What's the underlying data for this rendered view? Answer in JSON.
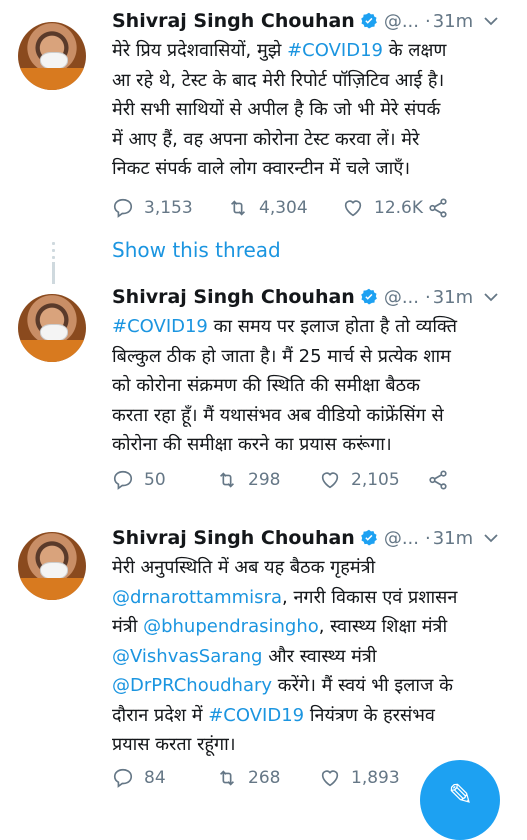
{
  "tweets": [
    {
      "name": "Shivraj Singh Chouhan",
      "handle": "@...",
      "dot": "·",
      "time": "31m",
      "lines": [
        {
          "segs": [
            {
              "t": "मेरे प्रिय प्रदेशवासियों, मुझे ",
              "c": "text"
            },
            {
              "t": "#COVID19",
              "c": "link"
            },
            {
              "t": " के लक्षण",
              "c": "text"
            }
          ]
        },
        {
          "segs": [
            {
              "t": "आ रहे थे, टेस्ट के बाद मेरी रिपोर्ट पॉज़िटिव आई है।",
              "c": "text"
            }
          ]
        },
        {
          "segs": [
            {
              "t": "मेरी सभी साथियों से अपील है कि जो भी मेरे संपर्क",
              "c": "text"
            }
          ]
        },
        {
          "segs": [
            {
              "t": "में आए हैं, वह अपना कोरोना टेस्ट करवा लें। मेरे",
              "c": "text"
            }
          ]
        },
        {
          "segs": [
            {
              "t": "निकट संपर्क वाले लोग क्वारन्टीन में चले जाएँ।",
              "c": "text"
            }
          ]
        }
      ],
      "replies": "3,153",
      "retweets": "4,304",
      "likes": "12.6K"
    },
    {
      "name": "Shivraj Singh Chouhan",
      "handle": "@...",
      "dot": "·",
      "time": "31m",
      "lines": [
        {
          "segs": [
            {
              "t": "#COVID19",
              "c": "link"
            },
            {
              "t": " का समय पर इलाज होता है तो व्यक्ति",
              "c": "text"
            }
          ]
        },
        {
          "segs": [
            {
              "t": "बिल्कुल ठीक हो जाता है। मैं 25 मार्च से प्रत्येक शाम",
              "c": "text"
            }
          ]
        },
        {
          "segs": [
            {
              "t": "को कोरोना संक्रमण की स्थिति की समीक्षा बैठक",
              "c": "text"
            }
          ]
        },
        {
          "segs": [
            {
              "t": "करता रहा हूँ। मैं यथासंभव अब वीडियो कांफ्रेंसिंग से",
              "c": "text"
            }
          ]
        },
        {
          "segs": [
            {
              "t": "कोरोना की समीक्षा करने का प्रयास करूंगा।",
              "c": "text"
            }
          ]
        }
      ],
      "replies": "50",
      "retweets": "298",
      "likes": "2,105"
    },
    {
      "name": "Shivraj Singh Chouhan",
      "handle": "@...",
      "dot": "·",
      "time": "31m",
      "lines": [
        {
          "segs": [
            {
              "t": "मेरी अनुपस्थिति में अब यह बैठक गृहमंत्री",
              "c": "text"
            }
          ]
        },
        {
          "segs": [
            {
              "t": "@drnarottammisra",
              "c": "link"
            },
            {
              "t": ", नगरी विकास एवं प्रशासन",
              "c": "text"
            }
          ]
        },
        {
          "segs": [
            {
              "t": "मंत्री ",
              "c": "text"
            },
            {
              "t": "@bhupendrasingho",
              "c": "link"
            },
            {
              "t": ", स्वास्थ्य शिक्षा मंत्री",
              "c": "text"
            }
          ]
        },
        {
          "segs": [
            {
              "t": "@VishvasSarang",
              "c": "link"
            },
            {
              "t": " और स्वास्थ्य मंत्री",
              "c": "text"
            }
          ]
        },
        {
          "segs": [
            {
              "t": "@DrPRChoudhary",
              "c": "link"
            },
            {
              "t": " करेंगे। मैं स्वयं भी इलाज के",
              "c": "text"
            }
          ]
        },
        {
          "segs": [
            {
              "t": "दौरान प्रदेश में ",
              "c": "text"
            },
            {
              "t": "#COVID19",
              "c": "link"
            },
            {
              "t": " नियंत्रण के हरसंभव",
              "c": "text"
            }
          ]
        },
        {
          "segs": [
            {
              "t": "प्रयास करता रहूंगा।",
              "c": "text"
            }
          ]
        }
      ],
      "replies": "84",
      "retweets": "268",
      "likes": "1,893"
    }
  ],
  "show_thread": "Show this thread",
  "colors": {
    "link": "#1b95e0",
    "muted": "#657786",
    "text": "#14171a",
    "accent": "#1da1f2"
  },
  "icons": [
    "verified-badge-icon",
    "chevron-down-icon",
    "reply-icon",
    "retweet-icon",
    "like-icon",
    "share-icon",
    "compose-icon"
  ]
}
